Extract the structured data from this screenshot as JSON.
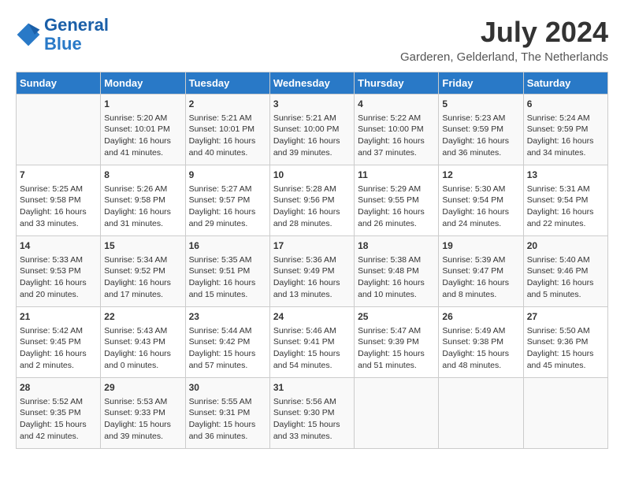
{
  "logo": {
    "line1": "General",
    "line2": "Blue"
  },
  "title": "July 2024",
  "location": "Garderen, Gelderland, The Netherlands",
  "days_of_week": [
    "Sunday",
    "Monday",
    "Tuesday",
    "Wednesday",
    "Thursday",
    "Friday",
    "Saturday"
  ],
  "weeks": [
    [
      {
        "day": "",
        "info": ""
      },
      {
        "day": "1",
        "info": "Sunrise: 5:20 AM\nSunset: 10:01 PM\nDaylight: 16 hours\nand 41 minutes."
      },
      {
        "day": "2",
        "info": "Sunrise: 5:21 AM\nSunset: 10:01 PM\nDaylight: 16 hours\nand 40 minutes."
      },
      {
        "day": "3",
        "info": "Sunrise: 5:21 AM\nSunset: 10:00 PM\nDaylight: 16 hours\nand 39 minutes."
      },
      {
        "day": "4",
        "info": "Sunrise: 5:22 AM\nSunset: 10:00 PM\nDaylight: 16 hours\nand 37 minutes."
      },
      {
        "day": "5",
        "info": "Sunrise: 5:23 AM\nSunset: 9:59 PM\nDaylight: 16 hours\nand 36 minutes."
      },
      {
        "day": "6",
        "info": "Sunrise: 5:24 AM\nSunset: 9:59 PM\nDaylight: 16 hours\nand 34 minutes."
      }
    ],
    [
      {
        "day": "7",
        "info": "Sunrise: 5:25 AM\nSunset: 9:58 PM\nDaylight: 16 hours\nand 33 minutes."
      },
      {
        "day": "8",
        "info": "Sunrise: 5:26 AM\nSunset: 9:58 PM\nDaylight: 16 hours\nand 31 minutes."
      },
      {
        "day": "9",
        "info": "Sunrise: 5:27 AM\nSunset: 9:57 PM\nDaylight: 16 hours\nand 29 minutes."
      },
      {
        "day": "10",
        "info": "Sunrise: 5:28 AM\nSunset: 9:56 PM\nDaylight: 16 hours\nand 28 minutes."
      },
      {
        "day": "11",
        "info": "Sunrise: 5:29 AM\nSunset: 9:55 PM\nDaylight: 16 hours\nand 26 minutes."
      },
      {
        "day": "12",
        "info": "Sunrise: 5:30 AM\nSunset: 9:54 PM\nDaylight: 16 hours\nand 24 minutes."
      },
      {
        "day": "13",
        "info": "Sunrise: 5:31 AM\nSunset: 9:54 PM\nDaylight: 16 hours\nand 22 minutes."
      }
    ],
    [
      {
        "day": "14",
        "info": "Sunrise: 5:33 AM\nSunset: 9:53 PM\nDaylight: 16 hours\nand 20 minutes."
      },
      {
        "day": "15",
        "info": "Sunrise: 5:34 AM\nSunset: 9:52 PM\nDaylight: 16 hours\nand 17 minutes."
      },
      {
        "day": "16",
        "info": "Sunrise: 5:35 AM\nSunset: 9:51 PM\nDaylight: 16 hours\nand 15 minutes."
      },
      {
        "day": "17",
        "info": "Sunrise: 5:36 AM\nSunset: 9:49 PM\nDaylight: 16 hours\nand 13 minutes."
      },
      {
        "day": "18",
        "info": "Sunrise: 5:38 AM\nSunset: 9:48 PM\nDaylight: 16 hours\nand 10 minutes."
      },
      {
        "day": "19",
        "info": "Sunrise: 5:39 AM\nSunset: 9:47 PM\nDaylight: 16 hours\nand 8 minutes."
      },
      {
        "day": "20",
        "info": "Sunrise: 5:40 AM\nSunset: 9:46 PM\nDaylight: 16 hours\nand 5 minutes."
      }
    ],
    [
      {
        "day": "21",
        "info": "Sunrise: 5:42 AM\nSunset: 9:45 PM\nDaylight: 16 hours\nand 2 minutes."
      },
      {
        "day": "22",
        "info": "Sunrise: 5:43 AM\nSunset: 9:43 PM\nDaylight: 16 hours\nand 0 minutes."
      },
      {
        "day": "23",
        "info": "Sunrise: 5:44 AM\nSunset: 9:42 PM\nDaylight: 15 hours\nand 57 minutes."
      },
      {
        "day": "24",
        "info": "Sunrise: 5:46 AM\nSunset: 9:41 PM\nDaylight: 15 hours\nand 54 minutes."
      },
      {
        "day": "25",
        "info": "Sunrise: 5:47 AM\nSunset: 9:39 PM\nDaylight: 15 hours\nand 51 minutes."
      },
      {
        "day": "26",
        "info": "Sunrise: 5:49 AM\nSunset: 9:38 PM\nDaylight: 15 hours\nand 48 minutes."
      },
      {
        "day": "27",
        "info": "Sunrise: 5:50 AM\nSunset: 9:36 PM\nDaylight: 15 hours\nand 45 minutes."
      }
    ],
    [
      {
        "day": "28",
        "info": "Sunrise: 5:52 AM\nSunset: 9:35 PM\nDaylight: 15 hours\nand 42 minutes."
      },
      {
        "day": "29",
        "info": "Sunrise: 5:53 AM\nSunset: 9:33 PM\nDaylight: 15 hours\nand 39 minutes."
      },
      {
        "day": "30",
        "info": "Sunrise: 5:55 AM\nSunset: 9:31 PM\nDaylight: 15 hours\nand 36 minutes."
      },
      {
        "day": "31",
        "info": "Sunrise: 5:56 AM\nSunset: 9:30 PM\nDaylight: 15 hours\nand 33 minutes."
      },
      {
        "day": "",
        "info": ""
      },
      {
        "day": "",
        "info": ""
      },
      {
        "day": "",
        "info": ""
      }
    ]
  ]
}
